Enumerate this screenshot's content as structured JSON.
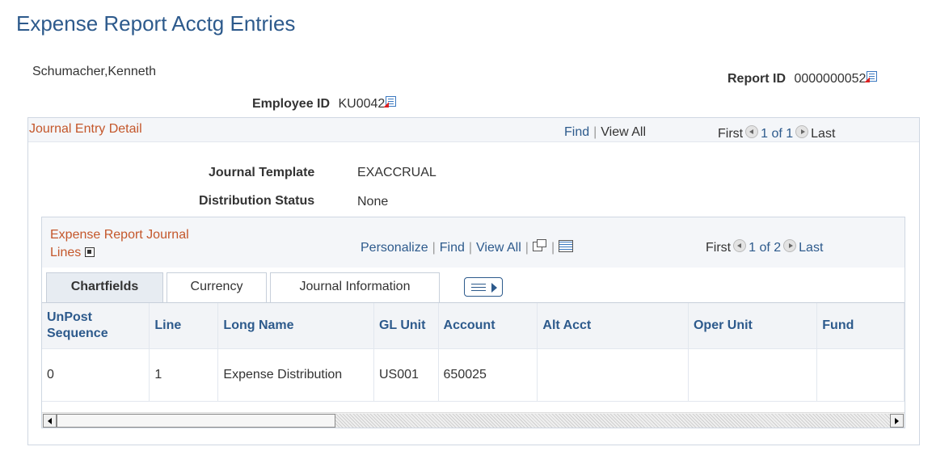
{
  "page": {
    "title": "Expense Report Acctg Entries",
    "employee_name": "Schumacher,Kenneth",
    "report_id_label": "Report ID",
    "report_id_value": "0000000052",
    "employee_id_label": "Employee ID",
    "employee_id_value": "KU0042"
  },
  "journal_entry_detail": {
    "title": "Journal Entry Detail",
    "find": "Find",
    "view_all": "View All",
    "first": "First",
    "count": "1 of 1",
    "last": "Last",
    "journal_template_label": "Journal Template",
    "journal_template_value": "EXACCRUAL",
    "distribution_status_label": "Distribution Status",
    "distribution_status_value": "None"
  },
  "journal_lines": {
    "title_line1": "Expense Report Journal",
    "title_line2": "Lines",
    "personalize": "Personalize",
    "find": "Find",
    "view_all": "View All",
    "first": "First",
    "count": "1 of 2",
    "last": "Last",
    "tabs": [
      "Chartfields",
      "Currency",
      "Journal Information"
    ],
    "columns": [
      "UnPost Sequence",
      "Line",
      "Long Name",
      "GL Unit",
      "Account",
      "Alt Acct",
      "Oper Unit",
      "Fund"
    ],
    "rows": [
      [
        "0",
        "1",
        "Expense Distribution",
        "US001",
        "650025",
        "",
        "",
        ""
      ]
    ]
  },
  "icons": {
    "lookup": "lookup-prompt-icon",
    "prev": "previous-row-icon",
    "next": "next-row-icon",
    "zoom": "zoom-icon",
    "download": "download-grid-icon",
    "collapse": "collapse-icon",
    "show_all_columns": "show-all-columns-icon"
  },
  "colors": {
    "title": "#2d5a8c",
    "section_title": "#c4572b",
    "link": "#2d5a8c"
  }
}
